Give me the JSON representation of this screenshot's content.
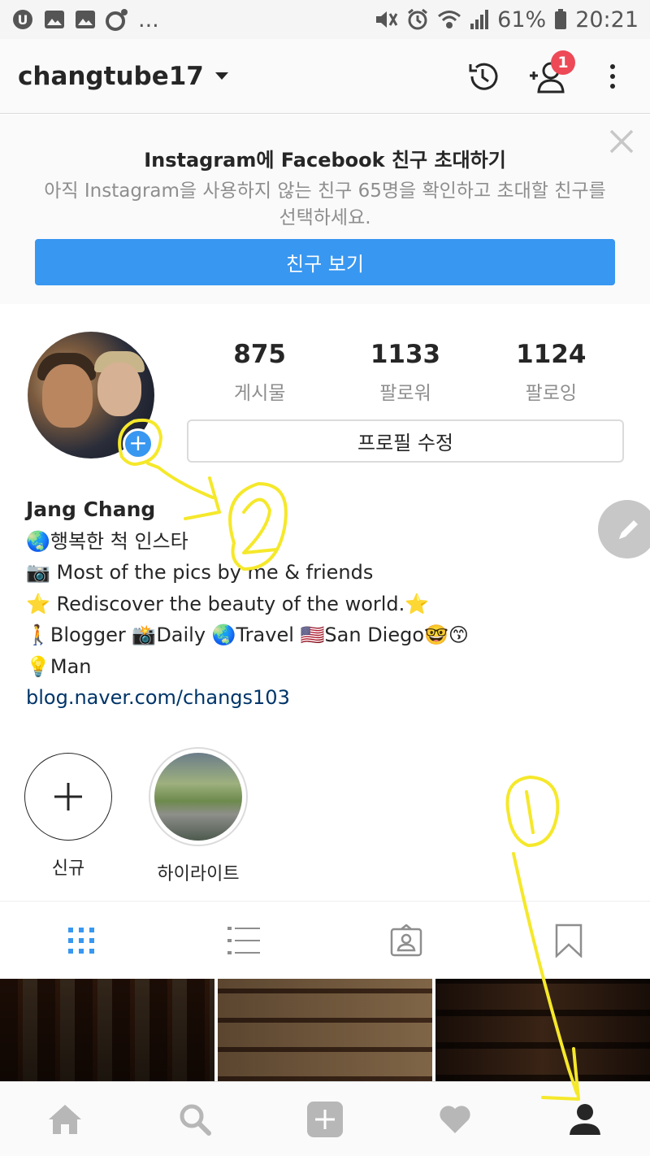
{
  "status_bar": {
    "ellipsis": "...",
    "battery": "61%",
    "time": "20:21"
  },
  "header": {
    "username": "changtube17",
    "notification_count": "1"
  },
  "invite_banner": {
    "title": "Instagram에 Facebook 친구 초대하기",
    "description": "아직 Instagram을 사용하지 않는 친구 65명을 확인하고 초대할 친구를 선택하세요.",
    "button_label": "친구 보기"
  },
  "profile": {
    "stats": [
      {
        "value": "875",
        "label": "게시물"
      },
      {
        "value": "1133",
        "label": "팔로워"
      },
      {
        "value": "1124",
        "label": "팔로잉"
      }
    ],
    "edit_button": "프로필 수정",
    "name": "Jang Chang",
    "bio_lines": [
      "🌏행복한 척 인스타",
      "📷 Most of the pics by me & friends",
      "⭐ Rediscover the beauty of the world.⭐",
      "🚶Blogger 📸Daily 🌏Travel  🇺🇸San Diego🤓😙",
      "💡Man"
    ],
    "link": "blog.naver.com/changs103"
  },
  "highlights": [
    {
      "label": "신규"
    },
    {
      "label": "하이라이트"
    }
  ],
  "annotations": {
    "one": "1",
    "two": "2"
  },
  "colors": {
    "accent": "#3897f0",
    "badge": "#ed4956",
    "annotation": "#f5e82a"
  }
}
